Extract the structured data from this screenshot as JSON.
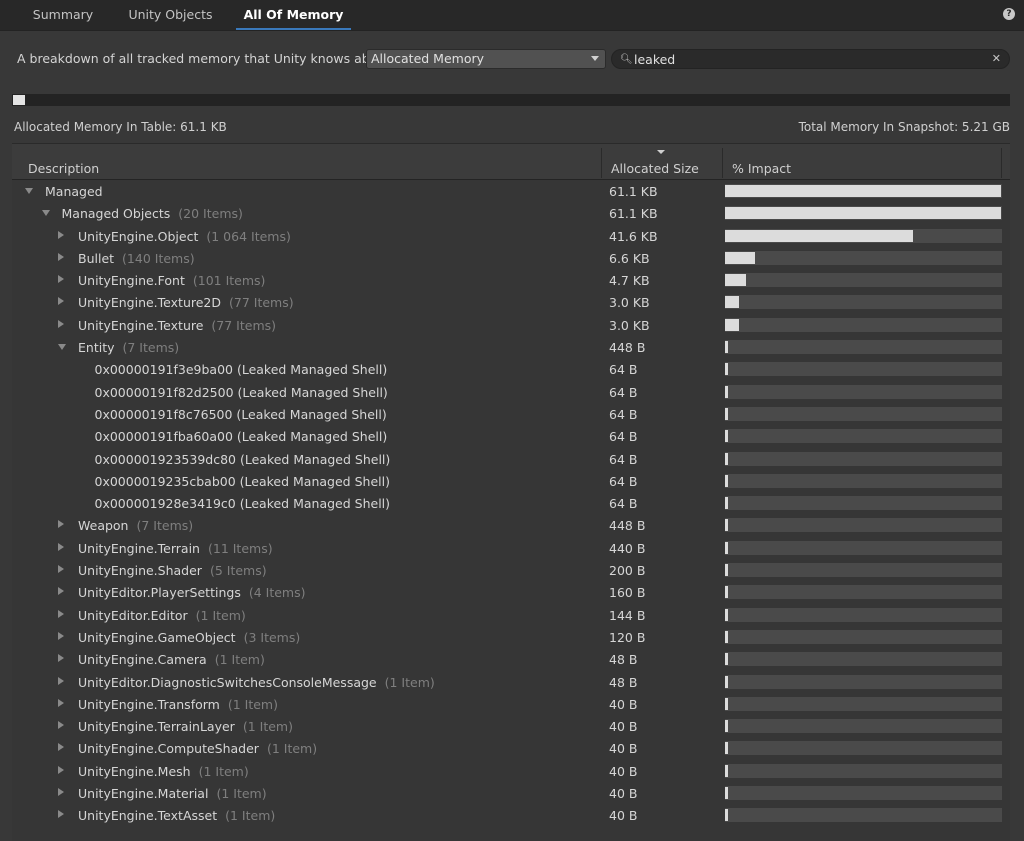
{
  "tabs": [
    {
      "label": "Summary",
      "active": false
    },
    {
      "label": "Unity Objects",
      "active": false
    },
    {
      "label": "All Of Memory",
      "active": true
    }
  ],
  "help_icon": "help-icon",
  "header": {
    "description": "A breakdown of all tracked memory that Unity knows about.",
    "dropdown_value": "Allocated Memory",
    "search_value": "leaked",
    "search_icon": "search-icon",
    "clear_icon": "clear-icon"
  },
  "progress_fraction": 0.0117,
  "allocated_in_table": "Allocated Memory In Table: 61.1 KB",
  "total_in_snapshot": "Total Memory In Snapshot: 5.21 GB",
  "table": {
    "columns": [
      "Description",
      "Allocated Size",
      "% Impact"
    ],
    "sorted_column": "Allocated Size",
    "rows": [
      {
        "depth": 0,
        "expand": "open",
        "name": "Managed",
        "count": "",
        "size": "61.1 KB",
        "impact": 1.0
      },
      {
        "depth": 1,
        "expand": "open",
        "name": "Managed Objects",
        "count": "(20 Items)",
        "size": "61.1 KB",
        "impact": 1.0
      },
      {
        "depth": 2,
        "expand": "closed",
        "name": "UnityEngine.Object",
        "count": "(1 064 Items)",
        "size": "41.6 KB",
        "impact": 0.68
      },
      {
        "depth": 2,
        "expand": "closed",
        "name": "Bullet",
        "count": "(140 Items)",
        "size": "6.6 KB",
        "impact": 0.108
      },
      {
        "depth": 2,
        "expand": "closed",
        "name": "UnityEngine.Font",
        "count": "(101 Items)",
        "size": "4.7 KB",
        "impact": 0.077
      },
      {
        "depth": 2,
        "expand": "closed",
        "name": "UnityEngine.Texture2D",
        "count": "(77 Items)",
        "size": "3.0 KB",
        "impact": 0.049
      },
      {
        "depth": 2,
        "expand": "closed",
        "name": "UnityEngine.Texture",
        "count": "(77 Items)",
        "size": "3.0 KB",
        "impact": 0.049
      },
      {
        "depth": 2,
        "expand": "open",
        "name": "Entity",
        "count": "(7 Items)",
        "size": "448 B",
        "impact": 0.0072
      },
      {
        "depth": 3,
        "expand": "none",
        "name": "0x00000191f3e9ba00 (Leaked Managed Shell)",
        "count": "",
        "size": "64 B",
        "impact": 0.001
      },
      {
        "depth": 3,
        "expand": "none",
        "name": "0x00000191f82d2500 (Leaked Managed Shell)",
        "count": "",
        "size": "64 B",
        "impact": 0.001
      },
      {
        "depth": 3,
        "expand": "none",
        "name": "0x00000191f8c76500 (Leaked Managed Shell)",
        "count": "",
        "size": "64 B",
        "impact": 0.001
      },
      {
        "depth": 3,
        "expand": "none",
        "name": "0x00000191fba60a00 (Leaked Managed Shell)",
        "count": "",
        "size": "64 B",
        "impact": 0.001
      },
      {
        "depth": 3,
        "expand": "none",
        "name": "0x000001923539dc80 (Leaked Managed Shell)",
        "count": "",
        "size": "64 B",
        "impact": 0.001
      },
      {
        "depth": 3,
        "expand": "none",
        "name": "0x0000019235cbab00 (Leaked Managed Shell)",
        "count": "",
        "size": "64 B",
        "impact": 0.001
      },
      {
        "depth": 3,
        "expand": "none",
        "name": "0x000001928e3419c0 (Leaked Managed Shell)",
        "count": "",
        "size": "64 B",
        "impact": 0.001
      },
      {
        "depth": 2,
        "expand": "closed",
        "name": "Weapon",
        "count": "(7 Items)",
        "size": "448 B",
        "impact": 0.0072
      },
      {
        "depth": 2,
        "expand": "closed",
        "name": "UnityEngine.Terrain",
        "count": "(11 Items)",
        "size": "440 B",
        "impact": 0.007
      },
      {
        "depth": 2,
        "expand": "closed",
        "name": "UnityEngine.Shader",
        "count": "(5 Items)",
        "size": "200 B",
        "impact": 0.003
      },
      {
        "depth": 2,
        "expand": "closed",
        "name": "UnityEditor.PlayerSettings",
        "count": "(4 Items)",
        "size": "160 B",
        "impact": 0.0026
      },
      {
        "depth": 2,
        "expand": "closed",
        "name": "UnityEditor.Editor",
        "count": "(1 Item)",
        "size": "144 B",
        "impact": 0.0023
      },
      {
        "depth": 2,
        "expand": "closed",
        "name": "UnityEngine.GameObject",
        "count": "(3 Items)",
        "size": "120 B",
        "impact": 0.0019
      },
      {
        "depth": 2,
        "expand": "closed",
        "name": "UnityEngine.Camera",
        "count": "(1 Item)",
        "size": "48 B",
        "impact": 0.0008
      },
      {
        "depth": 2,
        "expand": "closed",
        "name": "UnityEditor.DiagnosticSwitchesConsoleMessage",
        "count": "(1 Item)",
        "size": "48 B",
        "impact": 0.0008
      },
      {
        "depth": 2,
        "expand": "closed",
        "name": "UnityEngine.Transform",
        "count": "(1 Item)",
        "size": "40 B",
        "impact": 0.0006
      },
      {
        "depth": 2,
        "expand": "closed",
        "name": "UnityEngine.TerrainLayer",
        "count": "(1 Item)",
        "size": "40 B",
        "impact": 0.0006
      },
      {
        "depth": 2,
        "expand": "closed",
        "name": "UnityEngine.ComputeShader",
        "count": "(1 Item)",
        "size": "40 B",
        "impact": 0.0006
      },
      {
        "depth": 2,
        "expand": "closed",
        "name": "UnityEngine.Mesh",
        "count": "(1 Item)",
        "size": "40 B",
        "impact": 0.0006
      },
      {
        "depth": 2,
        "expand": "closed",
        "name": "UnityEngine.Material",
        "count": "(1 Item)",
        "size": "40 B",
        "impact": 0.0006
      },
      {
        "depth": 2,
        "expand": "closed",
        "name": "UnityEngine.TextAsset",
        "count": "(1 Item)",
        "size": "40 B",
        "impact": 0.0006
      }
    ]
  }
}
